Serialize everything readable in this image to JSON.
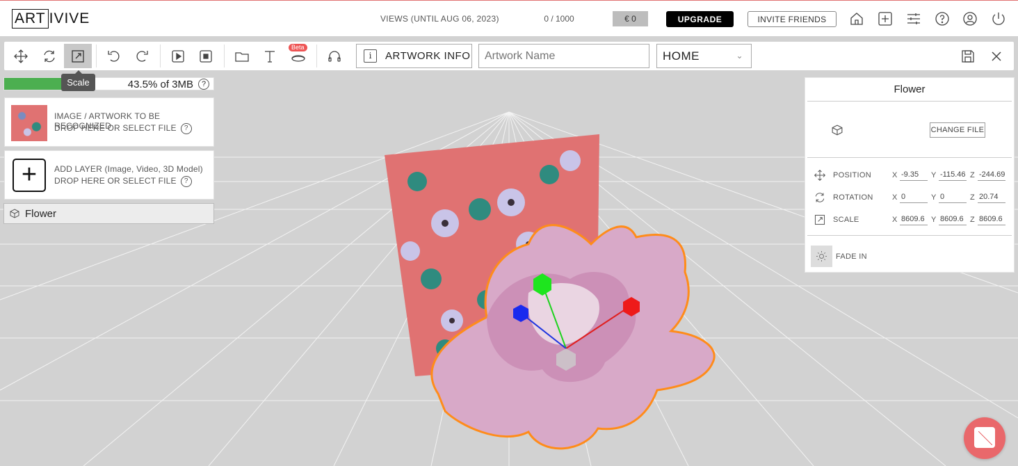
{
  "header": {
    "logo_box": "ART",
    "logo_rest": "IVIVE",
    "views_label": "VIEWS (UNTIL AUG 06, 2023)",
    "views_count": "0 / 1000",
    "balance": "€ 0",
    "upgrade_label": "UPGRADE",
    "invite_label": "INVITE FRIENDS"
  },
  "toolbar": {
    "beta_label": "Beta",
    "artwork_info_label": "ARTWORK INFO",
    "artwork_name_placeholder": "Artwork Name",
    "scene_select_value": "HOME"
  },
  "tooltip": {
    "label": "Scale"
  },
  "storage": {
    "used_fraction": 0.435,
    "label": "43.5% of 3MB"
  },
  "target_panel": {
    "line1": "IMAGE / ARTWORK TO BE RECOGNIZED",
    "line2": "DROP HERE OR SELECT FILE"
  },
  "layer_panel": {
    "line1": "ADD LAYER (Image, Video, 3D Model)",
    "line2": "DROP HERE OR SELECT FILE"
  },
  "layers": [
    {
      "name": "Flower"
    }
  ],
  "properties": {
    "title": "Flower",
    "change_file_label": "CHANGE FILE",
    "position": {
      "label": "POSITION",
      "x": "-9.35",
      "y": "-115.46",
      "z": "-244.69"
    },
    "rotation": {
      "label": "ROTATION",
      "x": "0",
      "y": "0",
      "z": "20.74"
    },
    "scale": {
      "label": "SCALE",
      "x": "8609.6",
      "y": "8609.6",
      "z": "8609.6"
    },
    "axis_x": "X",
    "axis_y": "Y",
    "axis_z": "Z",
    "fade_in_label": "FADE IN"
  },
  "colors": {
    "progress_fill": "#4caf50",
    "accent_red": "#e9686b",
    "selection_outline": "#ff8c1a"
  }
}
